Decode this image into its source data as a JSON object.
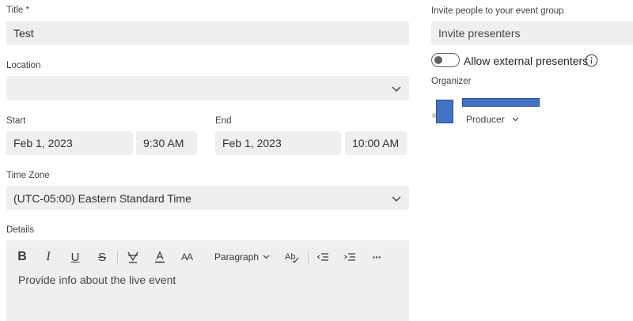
{
  "form": {
    "title_label": "Title *",
    "title_value": "Test",
    "location_label": "Location",
    "location_value": "",
    "start_label": "Start",
    "start_date": "Feb 1, 2023",
    "start_time": "9:30 AM",
    "end_label": "End",
    "end_date": "Feb 1, 2023",
    "end_time": "10:00 AM",
    "timezone_label": "Time Zone",
    "timezone_value": "(UTC-05:00) Eastern Standard Time",
    "details_label": "Details",
    "details_placeholder": "Provide info about the live event"
  },
  "toolbar": {
    "bold": "B",
    "italic": "I",
    "underline": "U",
    "strike": "S",
    "font_size_glyph": "AA",
    "paragraph_label": "Paragraph",
    "more": "···",
    "icons": [
      "bold-icon",
      "italic-icon",
      "underline-icon",
      "strikethrough-icon",
      "highlight-icon",
      "font-color-icon",
      "font-size-icon",
      "paragraph-dropdown",
      "spell-check-icon",
      "decrease-indent-icon",
      "increase-indent-icon",
      "more-options-icon"
    ]
  },
  "invite": {
    "label": "Invite people to your event group",
    "placeholder": "Invite presenters",
    "toggle_label": "Allow external presenters",
    "toggle_on": false,
    "organizer_label": "Organizer",
    "role_label": "Producer"
  },
  "colors": {
    "field_bg": "#f0efee",
    "redaction_blue": "#4472c4",
    "redaction_border": "#2f528f"
  }
}
